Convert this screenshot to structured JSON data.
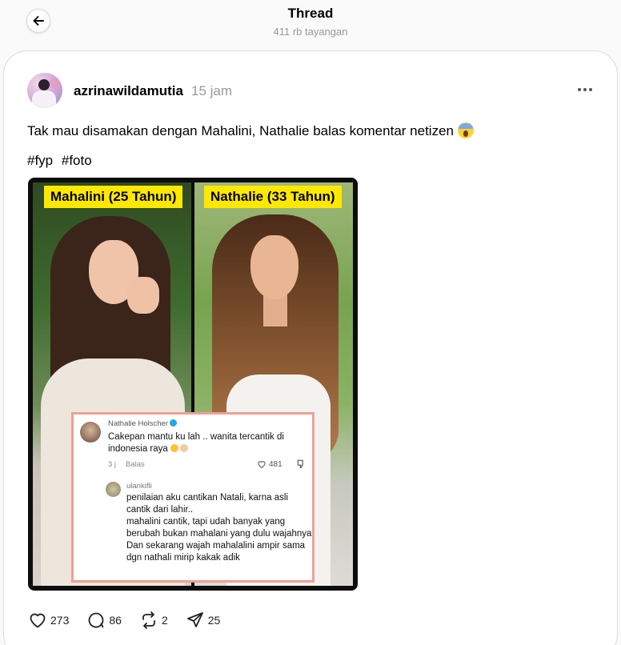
{
  "header": {
    "title": "Thread",
    "subtitle": "411 rb tayangan"
  },
  "post": {
    "username": "azrinawildamutia",
    "time": "15 jam",
    "caption": "Tak mau disamakan dengan Mahalini, Nathalie balas komentar netizen",
    "hashtags": [
      "#fyp",
      "#foto"
    ],
    "image": {
      "label_left": "Mahalini (25 Tahun)",
      "label_right": "Nathalie (33 Tahun)",
      "comment1": {
        "name": "Nathalie Holscher",
        "text": "Cakepan mantu ku lah .. wanita tercantik di indonesia raya",
        "time": "3 j",
        "reply": "Balas",
        "likes": "481"
      },
      "comment2": {
        "name": "ulankifli",
        "text_lines": [
          "penilaian aku cantikan Natali, karna asli cantik dari lahir..",
          "mahalini cantik, tapi udah banyak yang berubah bukan mahalani yang dulu wajahnya",
          "Dan sekarang wajah mahalalini ampir sama dgn nathali mirip kakak adik"
        ]
      }
    },
    "stats": {
      "likes": "273",
      "comments": "86",
      "reposts": "2",
      "shares": "25"
    }
  }
}
